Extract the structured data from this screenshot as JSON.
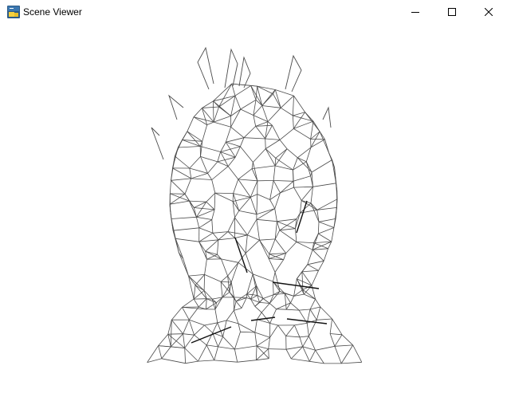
{
  "window": {
    "title": "Scene Viewer",
    "app_icon": "python-icon",
    "controls": {
      "minimize_icon": "minimize-icon",
      "maximize_icon": "maximize-icon",
      "close_icon": "close-icon"
    }
  },
  "scene": {
    "background": "#ffffff",
    "render_mode": "wireframe",
    "wire_color": "#4a4a4a",
    "subject": "head-mesh"
  }
}
